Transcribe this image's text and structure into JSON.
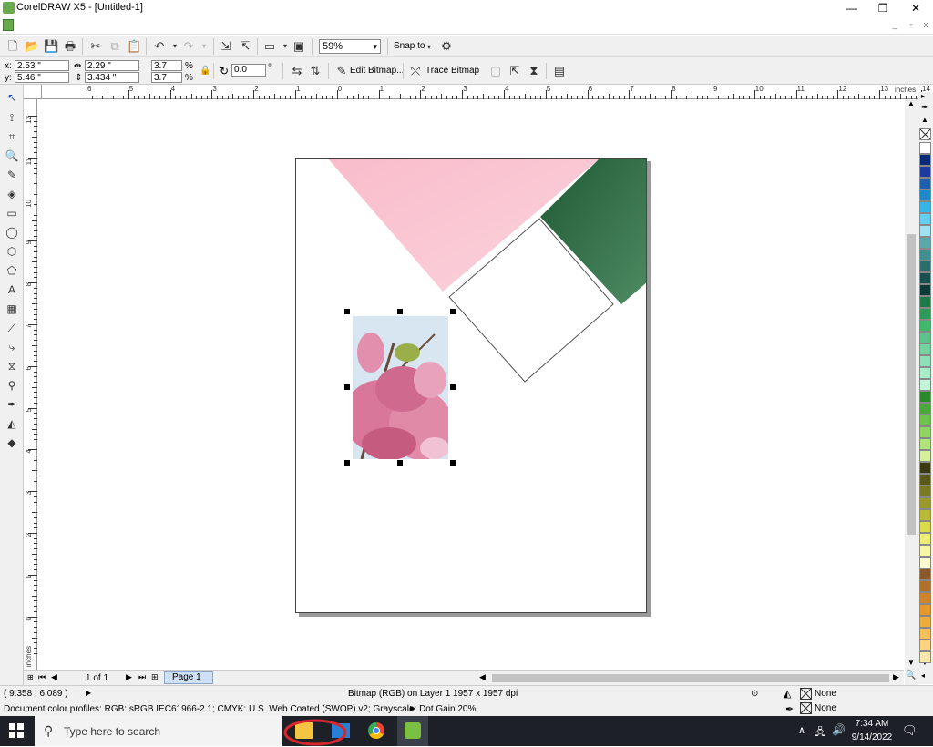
{
  "title_bar": {
    "title": "CorelDRAW X5 - [Untitled-1]"
  },
  "toolbar": {
    "zoom_value": "59%",
    "snap_to_label": "Snap to",
    "icons": [
      "new-icon",
      "open-icon",
      "save-icon",
      "print-icon",
      "cut-icon",
      "copy-icon",
      "paste-icon",
      "undo-icon",
      "redo-icon",
      "import-icon",
      "export-icon",
      "publish-pdf-icon",
      "application-launcher-icon",
      "welcome-screen-icon",
      "options-icon"
    ]
  },
  "property_bar": {
    "x_label": "x:",
    "x_value": "2.53 \"",
    "y_label": "y:",
    "y_value": "5.46 \"",
    "width_value": "2.29 \"",
    "height_value": "3.434 \"",
    "scale_x_value": "3.7",
    "scale_y_value": "3.7",
    "percent_sign": "%",
    "rotation_value": "0.0",
    "degree_sign": "°",
    "edit_bitmap_label": "Edit Bitmap...",
    "trace_bitmap_label": "Trace Bitmap"
  },
  "ruler": {
    "h_ticks": [
      "6",
      "5",
      "4",
      "3",
      "2",
      "1",
      "0",
      "1",
      "2",
      "3",
      "4",
      "5",
      "6",
      "7",
      "8",
      "9",
      "10",
      "11",
      "12",
      "13",
      "14"
    ],
    "h_unit": "inches",
    "v_ticks": [
      "12",
      "11",
      "10",
      "9",
      "8",
      "7",
      "6",
      "5",
      "4",
      "3",
      "2",
      "1",
      "0"
    ],
    "v_unit": "inches"
  },
  "page_nav": {
    "page_count": "1 of 1",
    "page_tab": "Page 1"
  },
  "status": {
    "cursor_position": "( 9.358 , 6.089 )",
    "object_info": "Bitmap (RGB) on Layer 1 1957 x 1957 dpi",
    "color_profiles": "Document color profiles: RGB: sRGB IEC61966-2.1; CMYK: U.S. Web Coated (SWOP) v2; Grayscale: Dot Gain 20%",
    "fill_value": "None",
    "outline_value": "None"
  },
  "taskbar": {
    "search_placeholder": "Type here to search",
    "time": "7:34 AM",
    "date": "9/14/2022"
  },
  "colors": {
    "pink_triangle": "#f9c6d2",
    "green_square": "#2f6b45",
    "taskbar_bg": "#1d2027",
    "highlight_ellipse": "#d7262d"
  },
  "palette": [
    "#ffffff",
    "#0a2a7a",
    "#1d3a9e",
    "#1e5fb0",
    "#1e88c8",
    "#35b5e8",
    "#63d0f0",
    "#9fe2f2",
    "#5aa8a8",
    "#3f8f8f",
    "#2a6e6e",
    "#1a4f4f",
    "#0f3a3a",
    "#1f7a4a",
    "#2e9a5a",
    "#3fb86c",
    "#5cc48a",
    "#74d4a0",
    "#8fe0b6",
    "#aaeec9",
    "#c4f5d8",
    "#2a8a2a",
    "#4aa83a",
    "#6cc44a",
    "#8ed660",
    "#b0e47a",
    "#d4f09a",
    "#3a3a10",
    "#5a5a18",
    "#7a7a22",
    "#9a9a2a",
    "#baba36",
    "#dada4a",
    "#eeee76",
    "#f6f6a6",
    "#fbfbd0",
    "#8a5a2a",
    "#b0702a",
    "#d0842a",
    "#e6982a",
    "#f0ac3a",
    "#f6c05a",
    "#fad480",
    "#fbe8b0"
  ]
}
